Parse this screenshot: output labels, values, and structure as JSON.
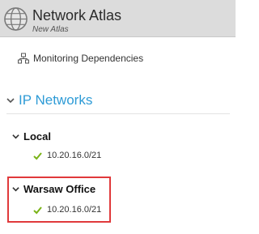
{
  "header": {
    "title": "Network Atlas",
    "subtitle": "New Atlas",
    "icon": "globe-icon"
  },
  "monitoring": {
    "label": "Monitoring Dependencies",
    "icon": "dependencies-icon"
  },
  "ip_networks": {
    "label": "IP Networks",
    "groups": [
      {
        "name": "Local",
        "networks": [
          "10.20.16.0/21"
        ]
      },
      {
        "name": "Warsaw Office",
        "networks": [
          "10.20.16.0/21"
        ]
      }
    ]
  },
  "colors": {
    "accent": "#2e9bd6",
    "check": "#7ab317",
    "highlight": "#e0393b",
    "header_bg": "#dcdcdc"
  }
}
